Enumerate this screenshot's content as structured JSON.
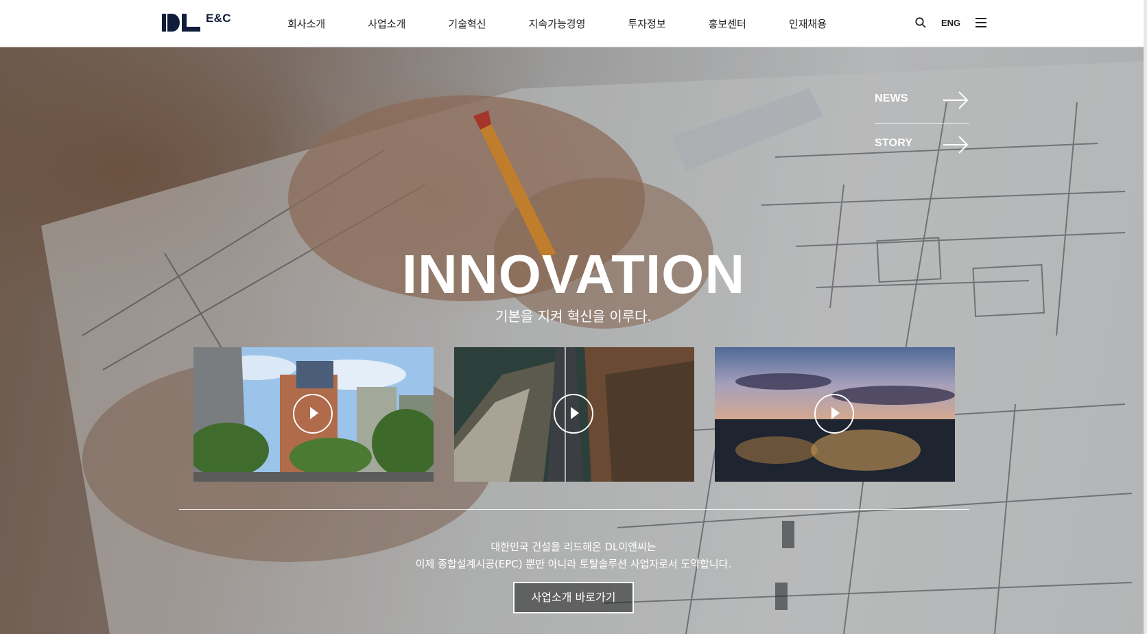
{
  "header": {
    "logo_suffix": "E&C",
    "nav": [
      {
        "label": "회사소개"
      },
      {
        "label": "사업소개"
      },
      {
        "label": "기술혁신"
      },
      {
        "label": "지속가능경영"
      },
      {
        "label": "투자정보"
      },
      {
        "label": "홍보센터"
      },
      {
        "label": "인재채용"
      }
    ],
    "lang": "ENG",
    "icons": {
      "search": "search-icon",
      "menu": "hamburger-menu-icon"
    }
  },
  "hero": {
    "side_links": [
      {
        "label": "NEWS",
        "icon": "arrow-right-icon"
      },
      {
        "label": "STORY",
        "icon": "arrow-right-icon"
      }
    ],
    "title": "INNOVATION",
    "subtitle": "기본을 지켜 혁신을 이루다.",
    "videos": [
      {
        "scene": "city-buildings",
        "icon": "play-icon"
      },
      {
        "scene": "aerial-bridge-road",
        "icon": "play-icon"
      },
      {
        "scene": "industrial-plant-night",
        "icon": "play-icon"
      }
    ],
    "description_line1": "대한민국 건설을 리드해온 DL이앤씨는",
    "description_line2": "이제 종합설계시공(EPC) 뿐만 아니라 토탈솔루션 사업자로서 도약합니다.",
    "cta_label": "사업소개 바로가기"
  },
  "colors": {
    "brand_navy": "#101c3a",
    "header_bg": "#ffffff",
    "hero_text": "#ffffff"
  }
}
